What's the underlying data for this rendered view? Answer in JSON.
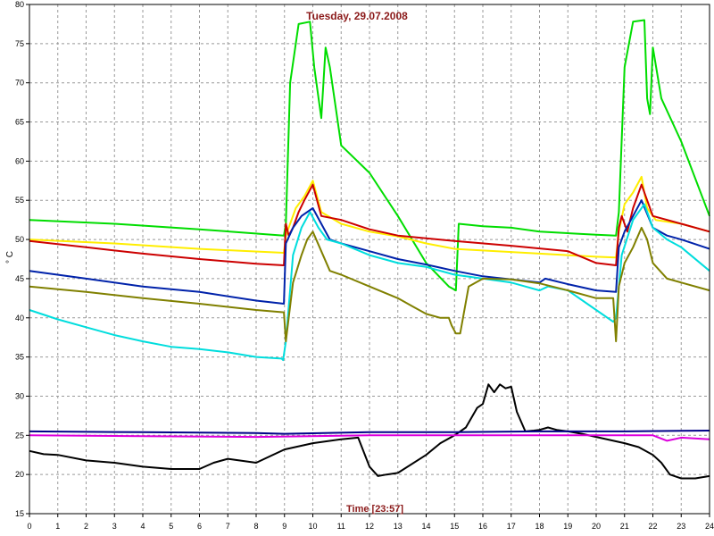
{
  "chart_data": {
    "type": "line",
    "title": "Tuesday, 29.07.2008",
    "xlabel": "Time [23:57]",
    "ylabel": "° C",
    "xlim": [
      0,
      24
    ],
    "ylim": [
      15,
      80
    ],
    "xticks": [
      0,
      1,
      2,
      3,
      4,
      5,
      6,
      7,
      8,
      9,
      10,
      11,
      12,
      13,
      14,
      15,
      16,
      17,
      18,
      19,
      20,
      21,
      22,
      23,
      24
    ],
    "yticks": [
      15,
      20,
      25,
      30,
      35,
      40,
      45,
      50,
      55,
      60,
      65,
      70,
      75,
      80
    ],
    "grid": true,
    "series": [
      {
        "color": "#00dd00",
        "x": [
          0,
          3,
          6,
          8.98,
          9.05,
          9.2,
          9.5,
          9.9,
          10.05,
          10.3,
          10.45,
          10.6,
          11,
          12,
          13,
          14,
          14.8,
          15.05,
          15.15,
          16,
          17,
          18,
          20,
          20.7,
          20.8,
          21.0,
          21.3,
          21.7,
          21.8,
          21.9,
          22,
          22.3,
          23,
          24
        ],
        "y": [
          52.5,
          52,
          51.3,
          50.5,
          52,
          70,
          77.5,
          77.8,
          72,
          65.5,
          74.5,
          72,
          62,
          58.5,
          53,
          47,
          44,
          43.5,
          52,
          51.7,
          51.5,
          51,
          50.6,
          50.5,
          53.5,
          72,
          77.8,
          78,
          68,
          66,
          74.5,
          68,
          62.5,
          53
        ]
      },
      {
        "color": "#ffee00",
        "x": [
          0,
          3,
          6,
          8.98,
          9.05,
          9.4,
          9.7,
          10,
          10.3,
          11,
          12,
          13,
          14,
          15,
          16,
          17,
          18,
          19,
          20,
          20.7,
          20.8,
          21,
          21.3,
          21.6,
          21.8,
          22.1,
          23,
          24
        ],
        "y": [
          50,
          49.5,
          48.8,
          48.3,
          50.5,
          54,
          55.5,
          57.5,
          53.5,
          52,
          51,
          50.4,
          49.5,
          48.8,
          48.6,
          48.4,
          48.2,
          48,
          47.8,
          47.7,
          51,
          54.5,
          56,
          58,
          54,
          52.5,
          52,
          51
        ]
      },
      {
        "color": "#cc0000",
        "x": [
          0,
          2,
          4,
          6,
          8,
          8.98,
          9.05,
          9.15,
          9.3,
          9.5,
          9.7,
          10,
          10.3,
          11,
          12,
          13,
          15,
          17,
          19,
          20,
          20.7,
          20.8,
          20.9,
          21.1,
          21.3,
          21.6,
          21.8,
          22,
          23,
          24
        ],
        "y": [
          49.8,
          49,
          48.2,
          47.5,
          46.9,
          46.7,
          52,
          50.5,
          51.5,
          53.5,
          55,
          57,
          53,
          52.5,
          51.3,
          50.5,
          49.8,
          49.2,
          48.5,
          47,
          46.7,
          51.5,
          53,
          51,
          54,
          57,
          55,
          53,
          52,
          51
        ]
      },
      {
        "color": "#0022aa",
        "x": [
          0,
          2,
          4,
          6,
          8,
          8.98,
          9.05,
          9.3,
          9.6,
          10,
          10.3,
          10.6,
          11,
          12,
          13,
          14,
          15,
          16,
          17,
          18,
          18.2,
          19,
          20,
          20.7,
          20.8,
          21,
          21.3,
          21.6,
          22,
          22.5,
          23,
          24
        ],
        "y": [
          46,
          45,
          44,
          43.3,
          42.2,
          41.8,
          49.5,
          51.5,
          53,
          54,
          52,
          50,
          49.5,
          48.5,
          47.5,
          46.8,
          46,
          45.3,
          44.9,
          44.5,
          45,
          44.3,
          43.5,
          43.3,
          49,
          51,
          53,
          55,
          51.5,
          50.5,
          50,
          48.8
        ]
      },
      {
        "color": "#00dddd",
        "x": [
          0,
          1,
          2,
          3,
          4,
          5,
          6,
          7,
          8,
          8.9,
          8.95,
          9.05,
          9.3,
          9.6,
          9.9,
          10.2,
          10.5,
          11,
          12,
          13,
          14,
          15,
          16,
          17,
          17.5,
          18,
          18.3,
          19,
          20,
          20.6,
          20.7,
          20.9,
          21.3,
          21.7,
          22,
          22.5,
          23,
          24
        ],
        "y": [
          41,
          39.8,
          38.8,
          37.8,
          37,
          36.3,
          36,
          35.6,
          35,
          34.8,
          34.6,
          37,
          48,
          51.5,
          53.5,
          51.5,
          50,
          49.5,
          48,
          47,
          46.5,
          45.5,
          45,
          44.5,
          44,
          43.5,
          44,
          43.5,
          41,
          39.5,
          40,
          48,
          52.5,
          54.5,
          51.5,
          50,
          49,
          46
        ]
      },
      {
        "color": "#808000",
        "x": [
          0,
          2,
          4,
          6,
          8,
          8.98,
          9.05,
          9.3,
          9.6,
          9.8,
          10,
          10.3,
          10.6,
          11,
          12,
          13,
          13.5,
          14,
          14.5,
          14.8,
          14.9,
          15.05,
          15.2,
          15.5,
          16,
          17,
          18,
          19,
          20,
          20.6,
          20.7,
          20.8,
          21,
          21.3,
          21.6,
          21.8,
          22,
          22.5,
          23,
          24
        ],
        "y": [
          44,
          43.3,
          42.5,
          41.8,
          41,
          40.7,
          37,
          44.5,
          48,
          50,
          51,
          48.5,
          46,
          45.5,
          44,
          42.5,
          41.5,
          40.5,
          40,
          40,
          39,
          38,
          38,
          44,
          45,
          44.9,
          44.4,
          43.5,
          42.5,
          42.5,
          37,
          44,
          47,
          49,
          51.5,
          50,
          47,
          45,
          44.5,
          43.5
        ]
      },
      {
        "color": "#000000",
        "x": [
          0,
          0.5,
          1,
          2,
          3,
          4,
          5,
          6,
          6.5,
          7,
          8,
          9,
          10,
          11,
          11.6,
          12,
          12.3,
          12.6,
          13,
          14,
          14.5,
          15,
          15.4,
          15.8,
          16,
          16.2,
          16.4,
          16.6,
          16.8,
          17,
          17.2,
          17.5,
          17.8,
          18,
          18.3,
          18.6,
          19,
          19.5,
          20,
          21,
          21.5,
          22,
          22.3,
          22.6,
          23,
          23.5,
          24
        ],
        "y": [
          23,
          22.6,
          22.5,
          21.8,
          21.5,
          21,
          20.7,
          20.7,
          21.5,
          22,
          21.5,
          23.2,
          24,
          24.5,
          24.7,
          21,
          19.8,
          20,
          20.2,
          22.5,
          24,
          25,
          26,
          28.5,
          29,
          31.5,
          30.5,
          31.5,
          31,
          31.2,
          28,
          25.5,
          25.6,
          25.7,
          26,
          25.7,
          25.5,
          25.2,
          24.8,
          24,
          23.5,
          22.5,
          21.5,
          20,
          19.5,
          19.5,
          19.8
        ]
      },
      {
        "color": "#dd00dd",
        "x": [
          0,
          4,
          8,
          12,
          16,
          20,
          22,
          22.5,
          23,
          24
        ],
        "y": [
          25,
          24.9,
          24.8,
          25,
          25,
          25,
          25,
          24.3,
          24.7,
          24.5
        ]
      },
      {
        "color": "#000088",
        "x": [
          0,
          4,
          8,
          9,
          12,
          15,
          18,
          21,
          24
        ],
        "y": [
          25.5,
          25.4,
          25.3,
          25.2,
          25.4,
          25.4,
          25.5,
          25.5,
          25.6
        ]
      }
    ]
  }
}
